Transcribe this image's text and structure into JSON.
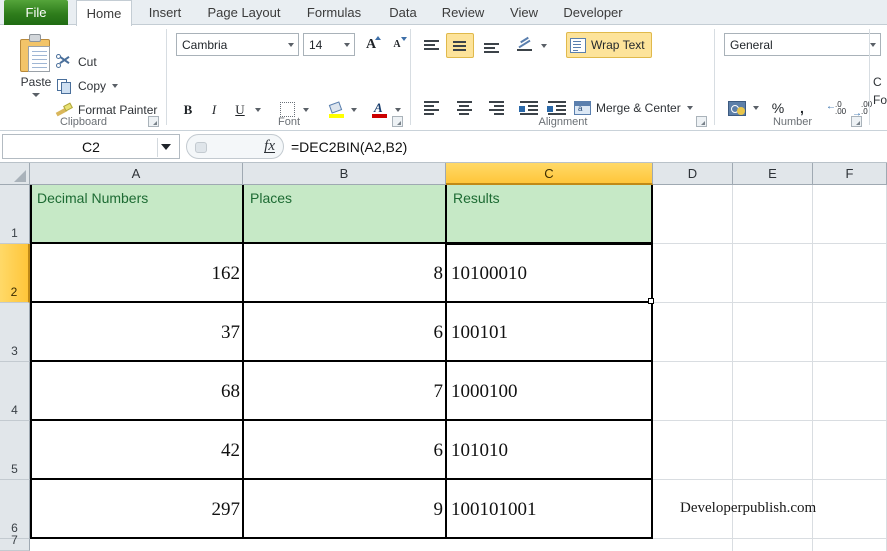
{
  "window": {
    "app": "Microsoft Excel"
  },
  "ribbon": {
    "file_tab": "File",
    "tabs": [
      {
        "label": "Home",
        "active": true
      },
      {
        "label": "Insert",
        "active": false
      },
      {
        "label": "Page Layout",
        "active": false
      },
      {
        "label": "Formulas",
        "active": false
      },
      {
        "label": "Data",
        "active": false
      },
      {
        "label": "Review",
        "active": false
      },
      {
        "label": "View",
        "active": false
      },
      {
        "label": "Developer",
        "active": false
      }
    ],
    "groups": {
      "clipboard": {
        "label": "Clipboard",
        "paste": "Paste",
        "cut": "Cut",
        "copy": "Copy",
        "format_painter": "Format Painter"
      },
      "font": {
        "label": "Font",
        "font_name": "Cambria",
        "font_size": "14",
        "bold": "B",
        "italic": "I",
        "underline": "U"
      },
      "alignment": {
        "label": "Alignment",
        "wrap_text": "Wrap Text",
        "merge_center": "Merge & Center"
      },
      "number": {
        "label": "Number",
        "format": "General",
        "percent": "%",
        "comma": ","
      },
      "styles": {
        "conditional_line1": "C",
        "conditional_line2": "Fo"
      }
    }
  },
  "formula_bar": {
    "name_box": "C2",
    "fx_label": "fx",
    "formula": "=DEC2BIN(A2,B2)"
  },
  "sheet": {
    "columns": [
      {
        "label": "A",
        "selected": false
      },
      {
        "label": "B",
        "selected": false
      },
      {
        "label": "C",
        "selected": true
      },
      {
        "label": "D",
        "selected": false
      },
      {
        "label": "E",
        "selected": false
      },
      {
        "label": "F",
        "selected": false
      }
    ],
    "rows": [
      {
        "num": "1",
        "selected": false
      },
      {
        "num": "2",
        "selected": true
      },
      {
        "num": "3",
        "selected": false
      },
      {
        "num": "4",
        "selected": false
      },
      {
        "num": "5",
        "selected": false
      },
      {
        "num": "6",
        "selected": false
      },
      {
        "num": "7",
        "selected": false
      }
    ],
    "headers": {
      "a": "Decimal Numbers",
      "b": "Places",
      "c": "Results"
    },
    "data": [
      {
        "decimal": "162",
        "places": "8",
        "result": "10100010"
      },
      {
        "decimal": "37",
        "places": "6",
        "result": "100101"
      },
      {
        "decimal": "68",
        "places": "7",
        "result": "1000100"
      },
      {
        "decimal": "42",
        "places": "6",
        "result": "101010"
      },
      {
        "decimal": "297",
        "places": "9",
        "result": "100101001"
      }
    ],
    "selected_cell": "C2",
    "watermark": "Developerpublish.com"
  },
  "colors": {
    "file_tab_green": "#2f7d1c",
    "header_fill": "#c6e9c6",
    "header_text": "#1d6b33",
    "selection_gold": "#ffc63a",
    "highlight_yellow": "#fde39a"
  }
}
